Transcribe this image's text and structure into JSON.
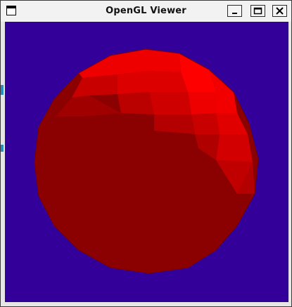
{
  "window": {
    "title": "OpenGL Viewer",
    "icons": {
      "app": "window-app-icon",
      "minimize": "minimize-icon",
      "maximize": "maximize-icon",
      "close": "close-icon"
    }
  },
  "scene": {
    "object": "sphere",
    "background_color": "#330099",
    "base_color": "#8b0000",
    "highlight_color": "#ff0000"
  }
}
